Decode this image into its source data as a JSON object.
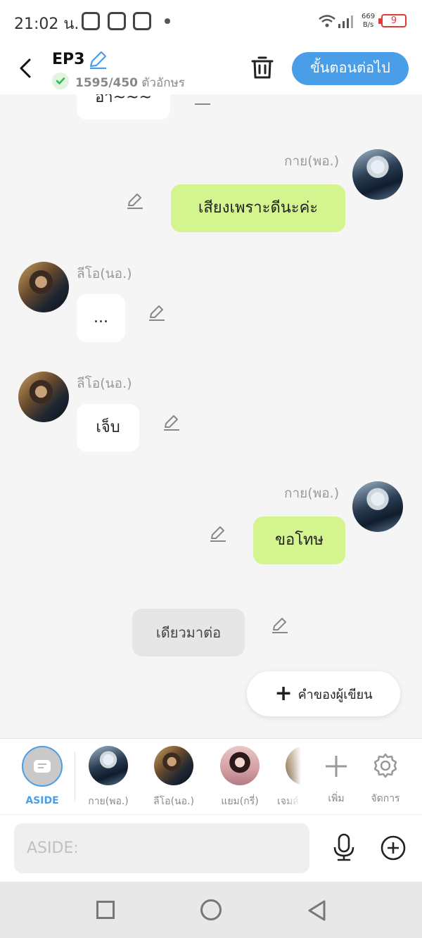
{
  "status_bar": {
    "time": "21:02 น.",
    "net_speed_value": "669",
    "net_speed_unit": "B/s",
    "battery": "9"
  },
  "header": {
    "title": "EP3",
    "char_count": "1595/450",
    "char_unit": "ตัวอักษร",
    "next_button": "ขั้นตอนต่อไป"
  },
  "messages": [
    {
      "type": "left",
      "text": "อ๋า~~~"
    },
    {
      "type": "right",
      "speaker": "กาย(พอ.)",
      "text": "เสียงเพราะดีนะค่ะ"
    },
    {
      "type": "left",
      "speaker": "ลีโอ(นอ.)",
      "text": "..."
    },
    {
      "type": "left",
      "speaker": "ลีโอ(นอ.)",
      "text": "เจ็บ"
    },
    {
      "type": "right",
      "speaker": "กาย(พอ.)",
      "text": "ขอโทษ"
    },
    {
      "type": "aside",
      "text": "เดียวมาต่อ"
    }
  ],
  "add_author_button": "คำของผู้เขียน",
  "character_bar": {
    "items": [
      {
        "label": "ASIDE",
        "active": true
      },
      {
        "label": "กาย(พอ.)"
      },
      {
        "label": "ลีโอ(นอ.)"
      },
      {
        "label": "แยม(กรี่)"
      },
      {
        "label": "เจมส์"
      }
    ],
    "add_label": "เพิ่ม",
    "manage_label": "จัดการ"
  },
  "input": {
    "placeholder": "ASIDE:"
  },
  "colors": {
    "accent": "#4a9ee8",
    "right_bubble": "#d4f48f",
    "battery_low": "#e53935"
  }
}
